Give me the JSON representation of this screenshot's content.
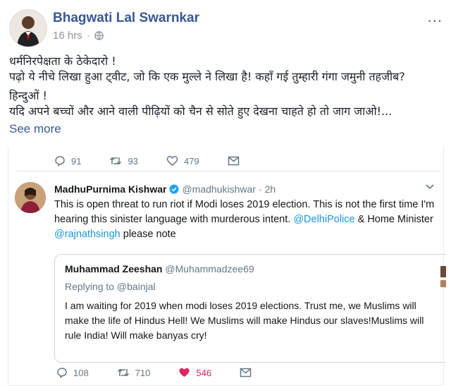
{
  "post": {
    "author": "Bhagwati Lal Swarnkar",
    "time": "16 hrs",
    "audience_icon": "globe-icon",
    "menu": "...",
    "lines": [
      "धर्मनिरपेक्षता के ठेकेदारो !",
      "पढ़ो ये नीचे लिखा हुआ ट्वीट, जो कि एक मुल्ले ने लिखा है! कहाँ गई तुम्हारी गंगा जमुनी तहजीब?",
      "हिन्दुओं !",
      "यदि अपने बच्चों और आने वाली पीढ़ियों को चैन से सोते हुए देखना चाहते हो तो जाग जाओ!..."
    ],
    "see_more": "See more"
  },
  "tweet": {
    "top_actions": {
      "replies": "91",
      "retweets": "93",
      "likes": "479"
    },
    "name": "MadhuPurnima Kishwar",
    "handle": "@madhukishwar",
    "sep": "·",
    "time": "2h",
    "text_plain_1": "This is open threat to run riot if Modi loses 2019 election. This is not the first time I'm hearing this sinister language with murderous intent. ",
    "mention_1": "@DelhiPolice",
    "text_plain_2": " &  Home Minister ",
    "mention_2": "@rajnathsingh",
    "text_plain_3": " please note",
    "quote": {
      "name": "Muhammad Zeeshan",
      "handle": "@Muhammadzee69",
      "replying": "Replying to @bainjal",
      "text": "I am waiting for 2019 when modi loses 2019 elections. Trust me, we Muslims will make the life of Hindus Hell! We Muslims will make Hindus our slaves!Muslims will rule India! Will make banyas cry!"
    },
    "bottom_actions": {
      "replies": "108",
      "retweets": "710",
      "likes": "546"
    }
  },
  "colors": {
    "link": "#385898",
    "twitter_link": "#1b95e0",
    "like_red": "#e0245e",
    "verified": "#1da1f2"
  }
}
